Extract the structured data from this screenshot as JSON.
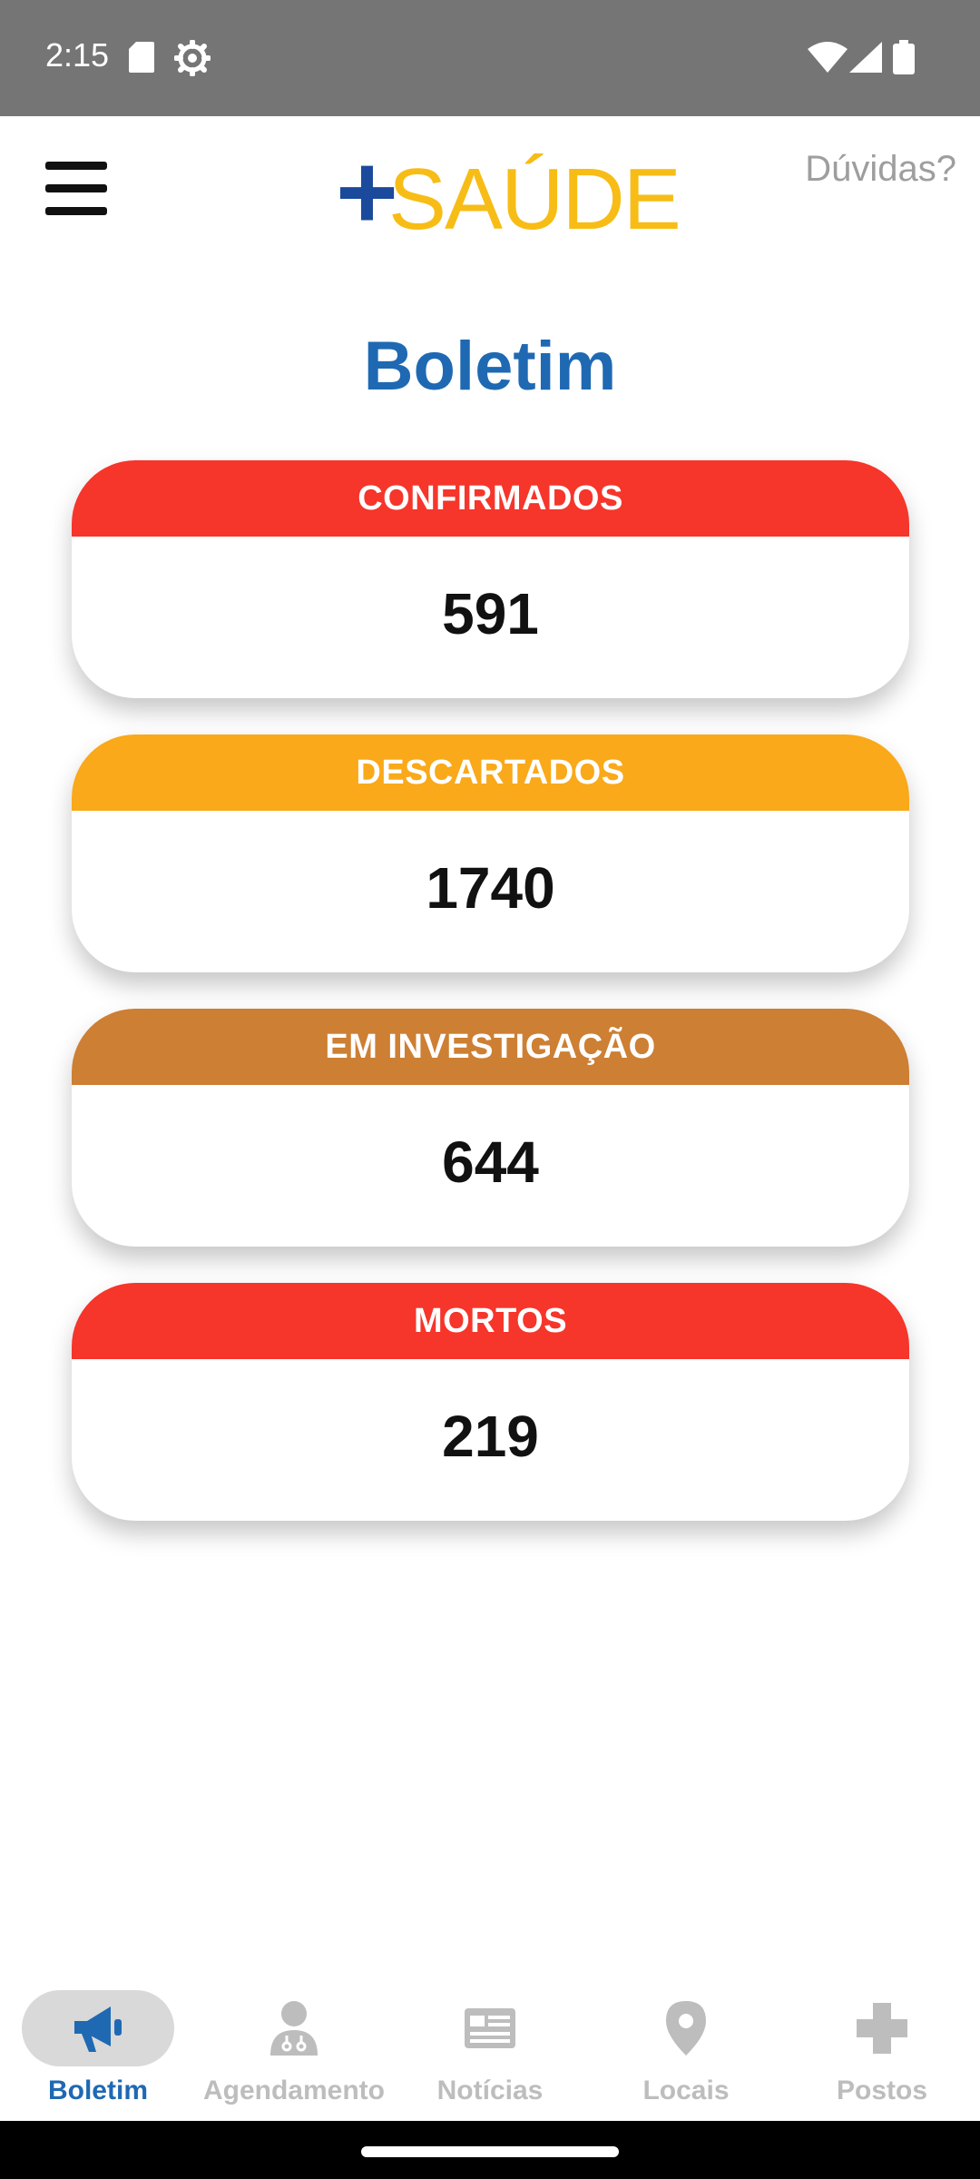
{
  "status_bar": {
    "time": "2:15",
    "icons": [
      "sd-card-icon",
      "settings-gear-icon",
      "wifi-icon",
      "signal-icon",
      "battery-icon"
    ]
  },
  "header": {
    "logo_plus": "+",
    "logo_text": "SAÚDE",
    "help_label": "Dúvidas?",
    "menu_icon": "hamburger-menu-icon"
  },
  "page": {
    "title": "Boletim"
  },
  "cards": [
    {
      "label": "CONFIRMADOS",
      "value": "591",
      "color": "#f6352b"
    },
    {
      "label": "DESCARTADOS",
      "value": "1740",
      "color": "#f9a919"
    },
    {
      "label": "EM INVESTIGAÇÃO",
      "value": "644",
      "color": "#cd7f33"
    },
    {
      "label": "MORTOS",
      "value": "219",
      "color": "#f6352b"
    }
  ],
  "nav": {
    "items": [
      {
        "label": "Boletim",
        "icon": "megaphone-icon",
        "active": true
      },
      {
        "label": "Agendamento",
        "icon": "doctor-icon",
        "active": false
      },
      {
        "label": "Notícias",
        "icon": "newspaper-icon",
        "active": false
      },
      {
        "label": "Locais",
        "icon": "location-pin-icon",
        "active": false
      },
      {
        "label": "Postos",
        "icon": "medical-cross-icon",
        "active": false
      }
    ]
  },
  "colors": {
    "brand_blue": "#1f69b3",
    "logo_blue": "#1b4a9c",
    "logo_yellow": "#f7bd16",
    "status_bar": "#757575",
    "nav_inactive": "#bdbdbd"
  }
}
